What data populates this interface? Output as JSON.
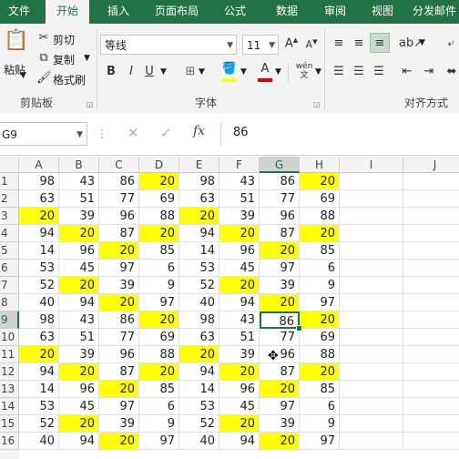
{
  "ribbon_tabs": [
    "文件",
    "开始",
    "插入",
    "页面布局",
    "公式",
    "数据",
    "审阅",
    "视图",
    "分发邮件"
  ],
  "active_tab_index": 1,
  "clipboard": {
    "paste": "粘贴",
    "cut": "剪切",
    "copy": "复制",
    "format_painter": "格式刷",
    "group_label": "剪贴板"
  },
  "font": {
    "name": "等线",
    "size": "11",
    "group_label": "字体",
    "bold": "B",
    "italic": "I",
    "underline": "U",
    "wen": "wén\n文"
  },
  "alignment": {
    "group_label": "对齐方式"
  },
  "formula_bar": {
    "name_box": "G9",
    "fx": "fx",
    "value": "86"
  },
  "columns": [
    "A",
    "B",
    "C",
    "D",
    "E",
    "F",
    "G",
    "H",
    "I",
    "J"
  ],
  "selected_column": "G",
  "selected_row": 9,
  "active_cell": "G9",
  "highlight_color": "#ffff00",
  "rows": [
    {
      "n": 1,
      "v": [
        98,
        43,
        86,
        20,
        98,
        43,
        86,
        20
      ],
      "hl": [
        3,
        7
      ]
    },
    {
      "n": 2,
      "v": [
        63,
        51,
        77,
        69,
        63,
        51,
        77,
        69
      ],
      "hl": []
    },
    {
      "n": 3,
      "v": [
        20,
        39,
        96,
        88,
        20,
        39,
        96,
        88
      ],
      "hl": [
        0,
        4
      ]
    },
    {
      "n": 4,
      "v": [
        94,
        20,
        87,
        20,
        94,
        20,
        87,
        20
      ],
      "hl": [
        1,
        3,
        5,
        7
      ]
    },
    {
      "n": 5,
      "v": [
        14,
        96,
        20,
        85,
        14,
        96,
        20,
        85
      ],
      "hl": [
        2,
        6
      ]
    },
    {
      "n": 6,
      "v": [
        53,
        45,
        97,
        6,
        53,
        45,
        97,
        6
      ],
      "hl": []
    },
    {
      "n": 7,
      "v": [
        52,
        20,
        39,
        9,
        52,
        20,
        39,
        9
      ],
      "hl": [
        1,
        5
      ]
    },
    {
      "n": 8,
      "v": [
        40,
        94,
        20,
        97,
        40,
        94,
        20,
        97
      ],
      "hl": [
        2,
        6
      ]
    },
    {
      "n": 9,
      "v": [
        98,
        43,
        86,
        20,
        98,
        43,
        86,
        20
      ],
      "hl": [
        3,
        7
      ]
    },
    {
      "n": 10,
      "v": [
        63,
        51,
        77,
        69,
        63,
        51,
        77,
        69
      ],
      "hl": []
    },
    {
      "n": 11,
      "v": [
        20,
        39,
        96,
        88,
        20,
        39,
        96,
        88
      ],
      "hl": [
        0,
        4
      ]
    },
    {
      "n": 12,
      "v": [
        94,
        20,
        87,
        20,
        94,
        20,
        87,
        20
      ],
      "hl": [
        1,
        3,
        5,
        7
      ]
    },
    {
      "n": 13,
      "v": [
        14,
        96,
        20,
        85,
        14,
        96,
        20,
        85
      ],
      "hl": [
        2,
        6
      ]
    },
    {
      "n": 14,
      "v": [
        53,
        45,
        97,
        6,
        53,
        45,
        97,
        6
      ],
      "hl": []
    },
    {
      "n": 15,
      "v": [
        52,
        20,
        39,
        9,
        52,
        20,
        39,
        9
      ],
      "hl": [
        1,
        5
      ]
    },
    {
      "n": 16,
      "v": [
        40,
        94,
        20,
        97,
        40,
        94,
        20,
        97
      ],
      "hl": [
        2,
        6
      ]
    }
  ]
}
